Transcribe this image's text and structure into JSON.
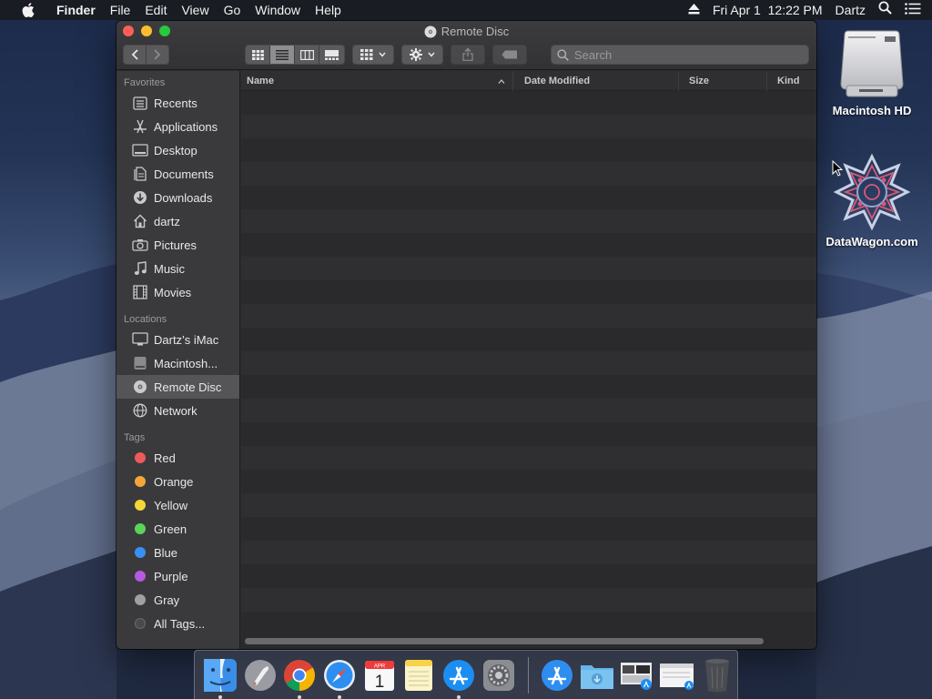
{
  "menubar": {
    "app_name": "Finder",
    "menus": [
      "File",
      "Edit",
      "View",
      "Go",
      "Window",
      "Help"
    ],
    "datetime": "Fri Apr 1  12:22 PM",
    "user": "Dartz"
  },
  "window": {
    "title": "Remote Disc",
    "search_placeholder": "Search",
    "columns": [
      "Name",
      "Date Modified",
      "Size",
      "Kind"
    ]
  },
  "sidebar": {
    "favorites_header": "Favorites",
    "favorites": [
      {
        "label": "Recents",
        "icon": "recents-icon"
      },
      {
        "label": "Applications",
        "icon": "applications-icon"
      },
      {
        "label": "Desktop",
        "icon": "desktop-icon"
      },
      {
        "label": "Documents",
        "icon": "documents-icon"
      },
      {
        "label": "Downloads",
        "icon": "downloads-icon"
      },
      {
        "label": "dartz",
        "icon": "home-icon"
      },
      {
        "label": "Pictures",
        "icon": "camera-icon"
      },
      {
        "label": "Music",
        "icon": "music-icon"
      },
      {
        "label": "Movies",
        "icon": "film-icon"
      }
    ],
    "locations_header": "Locations",
    "locations": [
      {
        "label": "Dartz’s iMac",
        "icon": "imac-icon"
      },
      {
        "label": "Macintosh...",
        "icon": "hard-drive-icon"
      },
      {
        "label": "Remote Disc",
        "icon": "disc-icon"
      },
      {
        "label": "Network",
        "icon": "network-icon"
      }
    ],
    "tags_header": "Tags",
    "tags": [
      {
        "label": "Red",
        "color": "#ee5a5a"
      },
      {
        "label": "Orange",
        "color": "#f5a53a"
      },
      {
        "label": "Yellow",
        "color": "#f5d63a"
      },
      {
        "label": "Green",
        "color": "#5ad35a"
      },
      {
        "label": "Blue",
        "color": "#3a8ff5"
      },
      {
        "label": "Purple",
        "color": "#b65ae0"
      },
      {
        "label": "Gray",
        "color": "#a0a0a0"
      },
      {
        "label": "All Tags...",
        "color": "#4a4a4a"
      }
    ]
  },
  "desktop": {
    "icons": [
      {
        "label": "Macintosh HD"
      },
      {
        "label": "DataWagon.com"
      }
    ]
  },
  "dock": {
    "items": [
      {
        "name": "Finder",
        "icon": "finder-icon"
      },
      {
        "name": "Launchpad",
        "icon": "launchpad-icon"
      },
      {
        "name": "Chrome",
        "icon": "chrome-icon"
      },
      {
        "name": "Safari",
        "icon": "safari-icon"
      },
      {
        "name": "Calendar",
        "icon": "calendar-icon",
        "month": "APR",
        "day": "1"
      },
      {
        "name": "Notes",
        "icon": "notes-icon"
      },
      {
        "name": "App Store",
        "icon": "app-store-icon"
      },
      {
        "name": "System Preferences",
        "icon": "system-preferences-icon"
      },
      {
        "name": "Applications",
        "icon": "applications-folder-icon"
      },
      {
        "name": "Downloads",
        "icon": "downloads-folder-icon"
      },
      {
        "name": "Screenshots",
        "icon": "screenshot-stack-icon"
      },
      {
        "name": "Document",
        "icon": "document-stack-icon"
      },
      {
        "name": "Trash",
        "icon": "trash-icon"
      }
    ]
  }
}
